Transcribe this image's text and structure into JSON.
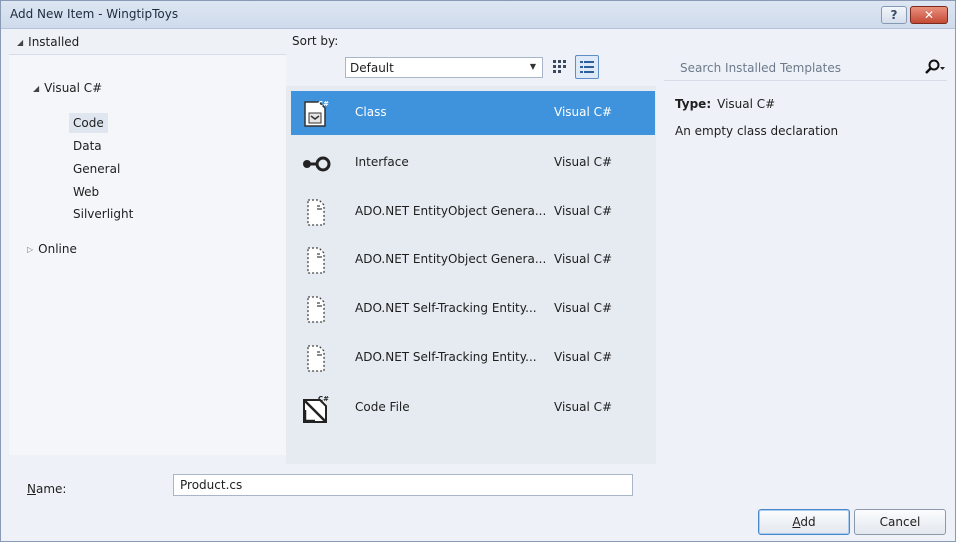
{
  "window": {
    "title": "Add New Item - WingtipToys",
    "help_glyph": "?",
    "close_glyph": "✕"
  },
  "left": {
    "header": "Installed",
    "tree": {
      "root": "Visual C#",
      "children": [
        "Code",
        "Data",
        "General",
        "Web",
        "Silverlight"
      ],
      "selected": "Code",
      "online": "Online"
    }
  },
  "toolbar": {
    "sort_label": "Sort by:",
    "sort_value": "Default"
  },
  "templates": [
    {
      "name": "Class",
      "lang": "Visual C#",
      "icon": "class-icon",
      "selected": true
    },
    {
      "name": "Interface",
      "lang": "Visual C#",
      "icon": "interface-icon",
      "selected": false
    },
    {
      "name": "ADO.NET EntityObject Genera...",
      "lang": "Visual C#",
      "icon": "document-icon",
      "selected": false
    },
    {
      "name": "ADO.NET EntityObject Genera...",
      "lang": "Visual C#",
      "icon": "document-icon",
      "selected": false
    },
    {
      "name": "ADO.NET Self-Tracking Entity...",
      "lang": "Visual C#",
      "icon": "document-icon",
      "selected": false
    },
    {
      "name": "ADO.NET Self-Tracking Entity...",
      "lang": "Visual C#",
      "icon": "document-icon",
      "selected": false
    },
    {
      "name": "Code File",
      "lang": "Visual C#",
      "icon": "code-file-icon",
      "selected": false
    }
  ],
  "search": {
    "placeholder": "Search Installed Templates"
  },
  "details": {
    "type_label": "Type:",
    "type_value": "Visual C#",
    "description": "An empty class declaration"
  },
  "form": {
    "name_label_accel": "N",
    "name_label_rest": "ame:",
    "name_value": "Product.cs"
  },
  "buttons": {
    "add_accel": "A",
    "add_rest": "dd",
    "cancel": "Cancel"
  },
  "colors": {
    "selection": "#3f93dd",
    "list_bg": "#e6ebf2",
    "window_bg": "#eef2f8"
  }
}
